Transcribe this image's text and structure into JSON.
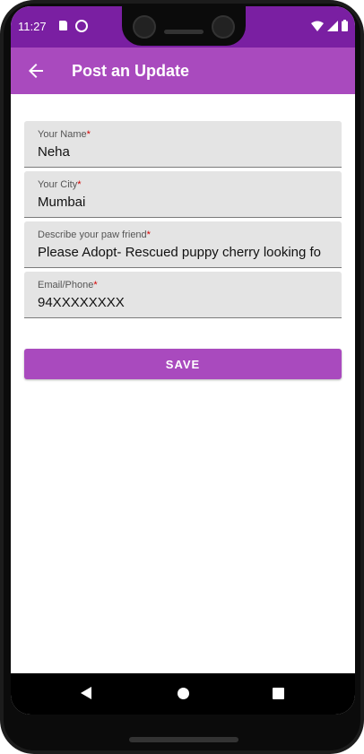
{
  "status_bar": {
    "time": "11:27",
    "icons": [
      "sd-card-icon",
      "sync-icon",
      "wifi-icon",
      "signal-icon",
      "battery-icon"
    ]
  },
  "app_bar": {
    "title": "Post an Update",
    "back_icon": "arrow-back-icon",
    "color": "#a94abe"
  },
  "form": {
    "fields": [
      {
        "label": "Your Name",
        "required_mark": "*",
        "value": "Neha"
      },
      {
        "label": "Your City",
        "required_mark": "*",
        "value": "Mumbai"
      },
      {
        "label": "Describe your paw friend",
        "required_mark": "*",
        "value": "Please Adopt- Rescued puppy cherry looking fo"
      },
      {
        "label": "Email/Phone",
        "required_mark": "*",
        "value": "94XXXXXXXX"
      }
    ],
    "save_label": "SAVE"
  },
  "nav_bar": {
    "icons": [
      "nav-back-icon",
      "nav-home-icon",
      "nav-recents-icon"
    ]
  },
  "colors": {
    "status_bar": "#7a1fa2",
    "accent": "#a94abe",
    "required": "#d40000"
  }
}
